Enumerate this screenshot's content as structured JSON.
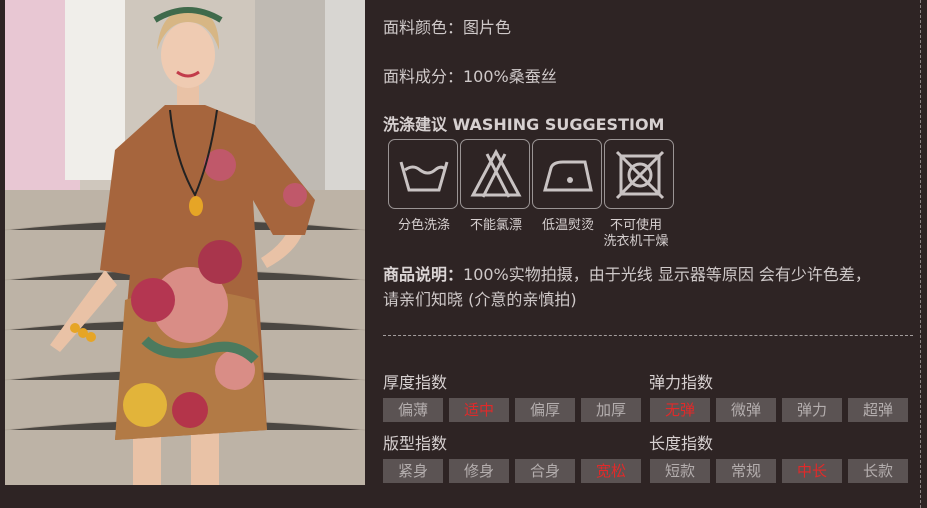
{
  "fabric": {
    "color_line": "面料颜色：图片色",
    "composition_line": "面料成分：100%桑蚕丝"
  },
  "washing": {
    "title": "洗涤建议 WASHING SUGGESTIOM",
    "icons": [
      {
        "icon": "hand-wash-icon",
        "label": "分色洗涤"
      },
      {
        "icon": "no-bleach-icon",
        "label": "不能氯漂"
      },
      {
        "icon": "low-iron-icon",
        "label": "低温熨烫"
      },
      {
        "icon": "no-machine-dry-icon",
        "label_line1": "不可使用",
        "label_line2": "洗衣机干燥"
      }
    ]
  },
  "description": {
    "label": "商品说明：",
    "text": "100%实物拍摄，由于光线 显示器等原因 会有少许色差，",
    "text2": "请亲们知晓 (介意的亲慎拍)"
  },
  "indices": {
    "thickness": {
      "title": "厚度指数",
      "options": [
        "偏薄",
        "适中",
        "偏厚",
        "加厚"
      ],
      "selected": "适中"
    },
    "elasticity": {
      "title": "弹力指数",
      "options": [
        "无弹",
        "微弹",
        "弹力",
        "超弹"
      ],
      "selected": "无弹"
    },
    "fit": {
      "title": "版型指数",
      "options": [
        "紧身",
        "修身",
        "合身",
        "宽松"
      ],
      "selected": "宽松"
    },
    "length": {
      "title": "长度指数",
      "options": [
        "短款",
        "常规",
        "中长",
        "长款"
      ],
      "selected": "中长"
    }
  },
  "colors": {
    "background": "#2e2424",
    "chip": "#5b5353",
    "selected_text": "#e02a2a"
  }
}
